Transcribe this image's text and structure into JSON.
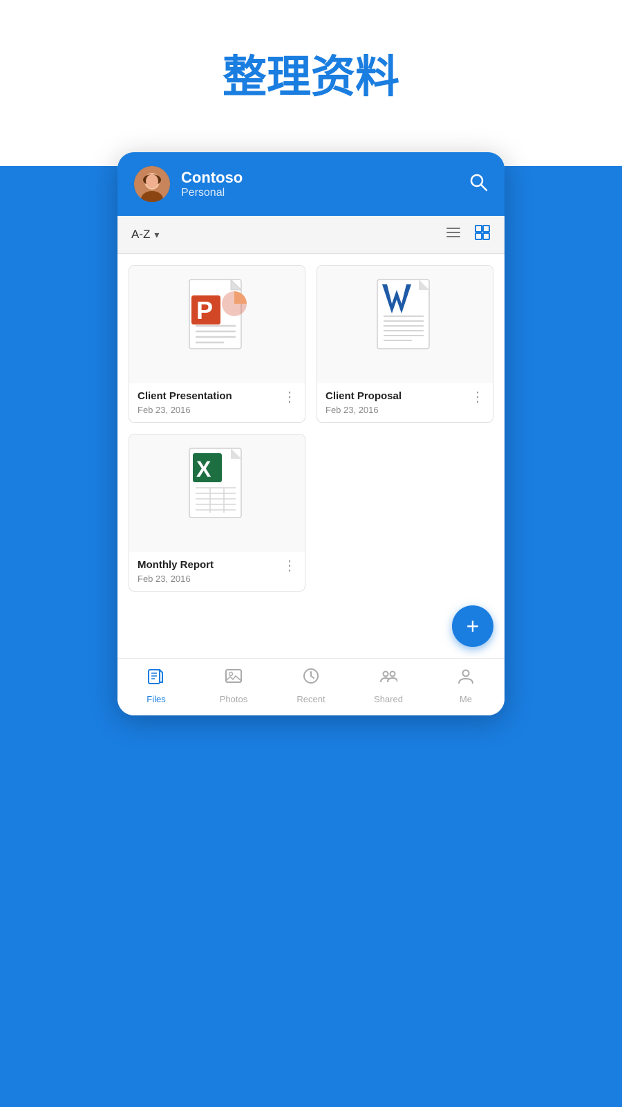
{
  "page": {
    "title": "整理资料",
    "background_color": "#1a7de0"
  },
  "header": {
    "name": "Contoso",
    "subtitle": "Personal",
    "search_label": "search"
  },
  "toolbar": {
    "sort_label": "A-Z",
    "sort_icon": "▾",
    "list_view_icon": "≡",
    "grid_view_icon": "⊞"
  },
  "files": [
    {
      "name": "Client Presentation",
      "date": "Feb 23, 2016",
      "type": "ppt",
      "more_label": "⋮"
    },
    {
      "name": "Client Proposal",
      "date": "Feb 23, 2016",
      "type": "word",
      "more_label": "⋮"
    },
    {
      "name": "Monthly Report",
      "date": "Feb 23, 2016",
      "type": "excel",
      "more_label": "⋮"
    }
  ],
  "fab": {
    "label": "+"
  },
  "nav": {
    "items": [
      {
        "id": "files",
        "label": "Files",
        "active": true
      },
      {
        "id": "photos",
        "label": "Photos",
        "active": false
      },
      {
        "id": "recent",
        "label": "Recent",
        "active": false
      },
      {
        "id": "shared",
        "label": "Shared",
        "active": false
      },
      {
        "id": "me",
        "label": "Me",
        "active": false
      }
    ]
  }
}
